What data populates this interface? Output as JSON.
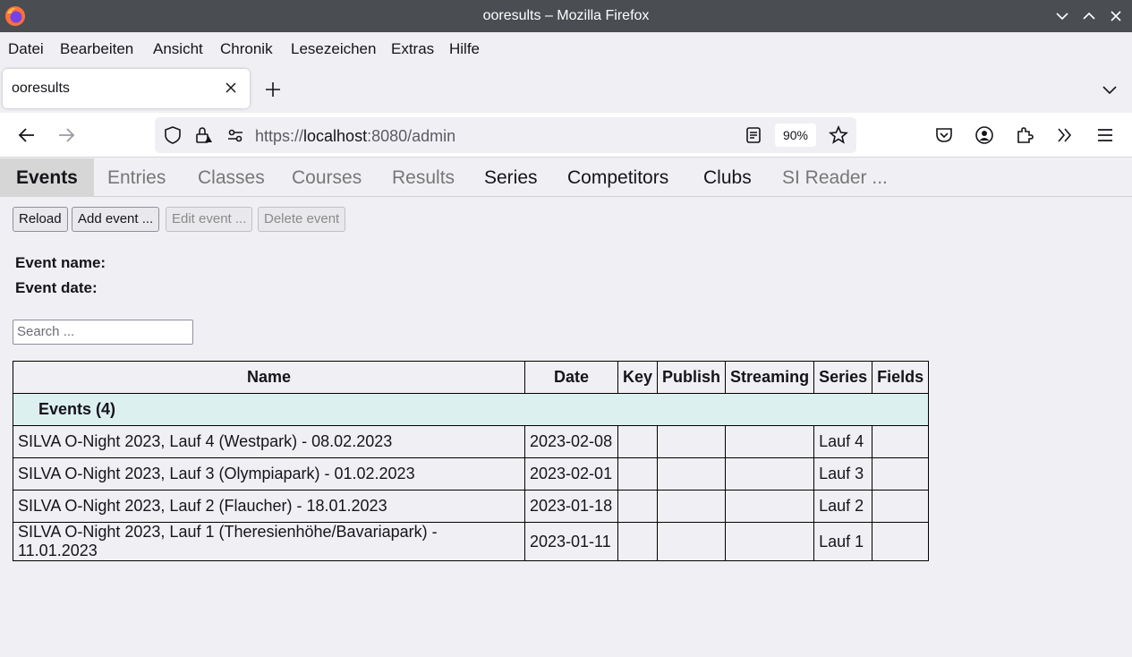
{
  "window": {
    "title": "ooresults – Mozilla Firefox"
  },
  "menu": [
    "Datei",
    "Bearbeiten",
    "Ansicht",
    "Chronik",
    "Lesezeichen",
    "Extras",
    "Hilfe"
  ],
  "tab": {
    "title": "ooresults"
  },
  "url": {
    "scheme": "https://",
    "host": "localhost",
    "rest": ":8080/admin"
  },
  "zoom": "90%",
  "app_tabs": [
    {
      "label": "Events",
      "state": "active"
    },
    {
      "label": "Entries",
      "state": "disabled"
    },
    {
      "label": "Classes",
      "state": "disabled"
    },
    {
      "label": "Courses",
      "state": "disabled"
    },
    {
      "label": "Results",
      "state": "disabled"
    },
    {
      "label": "Series",
      "state": "normal"
    },
    {
      "label": "Competitors",
      "state": "normal"
    },
    {
      "label": "Clubs",
      "state": "normal"
    },
    {
      "label": "SI Reader ...",
      "state": "disabled"
    }
  ],
  "buttons": {
    "reload": "Reload",
    "add": "Add event ...",
    "edit": "Edit event ...",
    "delete": "Delete event"
  },
  "event_info": {
    "name_label": "Event name:",
    "date_label": "Event date:"
  },
  "search": {
    "placeholder": "Search ..."
  },
  "table": {
    "headers": [
      "Name",
      "Date",
      "Key",
      "Publish",
      "Streaming",
      "Series",
      "Fields"
    ],
    "group_label": "Events  (4)",
    "rows": [
      {
        "name": "SILVA O-Night 2023, Lauf 4 (Westpark) - 08.02.2023",
        "date": "2023-02-08",
        "key": "",
        "publish": "",
        "streaming": "",
        "series": "Lauf 4",
        "fields": ""
      },
      {
        "name": "SILVA O-Night 2023, Lauf 3 (Olympiapark) - 01.02.2023",
        "date": "2023-02-01",
        "key": "",
        "publish": "",
        "streaming": "",
        "series": "Lauf 3",
        "fields": ""
      },
      {
        "name": "SILVA O-Night 2023, Lauf 2 (Flaucher) - 18.01.2023",
        "date": "2023-01-18",
        "key": "",
        "publish": "",
        "streaming": "",
        "series": "Lauf 2",
        "fields": ""
      },
      {
        "name": "SILVA O-Night 2023, Lauf 1 (Theresienhöhe/Bavariapark) - 11.01.2023",
        "date": "2023-01-11",
        "key": "",
        "publish": "",
        "streaming": "",
        "series": "Lauf 1",
        "fields": ""
      }
    ]
  }
}
